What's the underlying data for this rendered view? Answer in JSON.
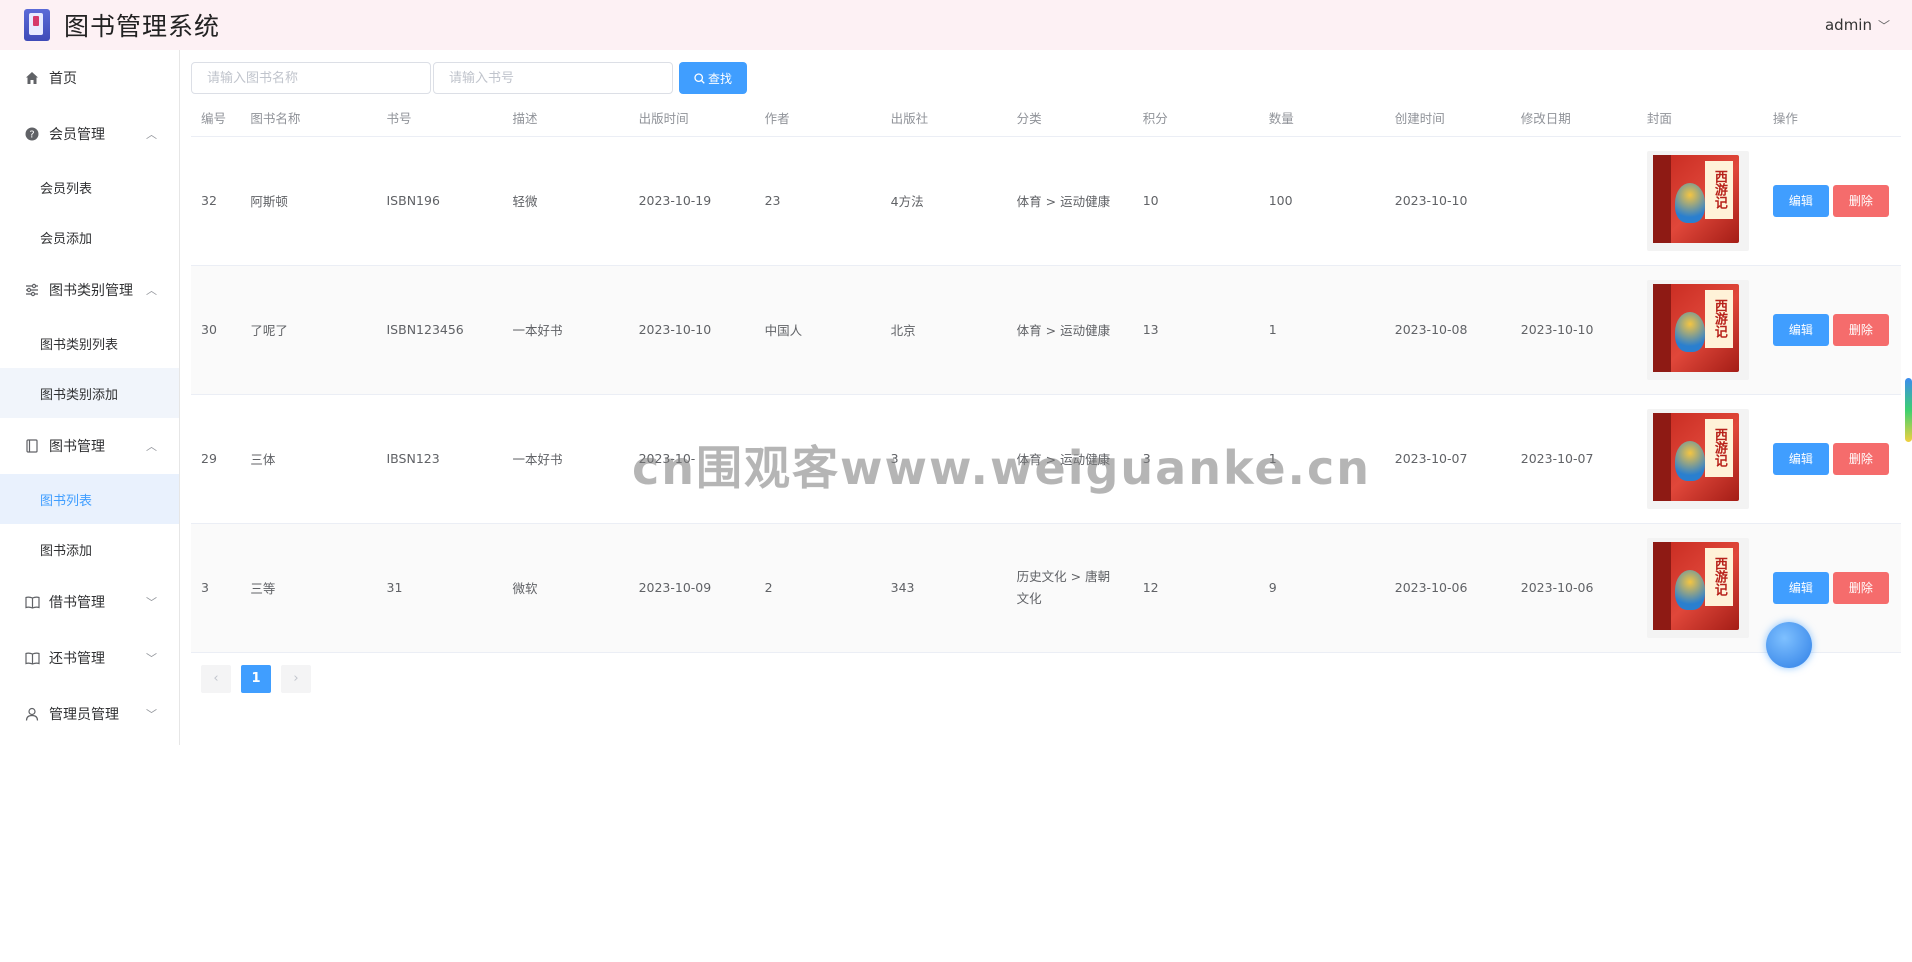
{
  "header": {
    "title": "图书管理系统",
    "user": "admin"
  },
  "sidebar": {
    "items": [
      {
        "label": "首页",
        "icon": "home-icon"
      },
      {
        "label": "会员管理",
        "icon": "question-circle-icon",
        "children": [
          "会员列表",
          "会员添加"
        ]
      },
      {
        "label": "图书类别管理",
        "icon": "sliders-icon",
        "children": [
          "图书类别列表",
          "图书类别添加"
        ]
      },
      {
        "label": "图书管理",
        "icon": "notebook-icon",
        "children": [
          "图书列表",
          "图书添加"
        ]
      },
      {
        "label": "借书管理",
        "icon": "open-book-icon"
      },
      {
        "label": "还书管理",
        "icon": "open-book-icon"
      },
      {
        "label": "管理员管理",
        "icon": "user-icon"
      }
    ]
  },
  "search": {
    "name_placeholder": "请输入图书名称",
    "isbn_placeholder": "请输入书号",
    "button": "查找"
  },
  "table": {
    "columns": [
      "编号",
      "图书名称",
      "书号",
      "描述",
      "出版时间",
      "作者",
      "出版社",
      "分类",
      "积分",
      "数量",
      "创建时间",
      "修改日期",
      "封面",
      "操作"
    ],
    "rows": [
      {
        "id": "32",
        "name": "阿斯顿",
        "isbn": "ISBN196",
        "desc": "轻微",
        "pub_date": "2023-10-19",
        "author": "23",
        "publisher": "4方法",
        "category": "体育 > 运动健康",
        "points": "10",
        "qty": "100",
        "created": "2023-10-10",
        "modified": ""
      },
      {
        "id": "30",
        "name": "了呢了",
        "isbn": "ISBN123456",
        "desc": "一本好书",
        "pub_date": "2023-10-10",
        "author": "中国人",
        "publisher": "北京",
        "category": "体育 > 运动健康",
        "points": "13",
        "qty": "1",
        "created": "2023-10-08",
        "modified": "2023-10-10"
      },
      {
        "id": "29",
        "name": "三体",
        "isbn": "IBSN123",
        "desc": "一本好书",
        "pub_date": "2023-10-",
        "author": "",
        "publisher": "3",
        "category": "体育 > 运动健康",
        "points": "3",
        "qty": "1",
        "created": "2023-10-07",
        "modified": "2023-10-07"
      },
      {
        "id": "3",
        "name": "三等",
        "isbn": "31",
        "desc": "微软",
        "pub_date": "2023-10-09",
        "author": "2",
        "publisher": "343",
        "category": "历史文化 > 唐朝文化",
        "points": "12",
        "qty": "9",
        "created": "2023-10-06",
        "modified": "2023-10-06"
      }
    ],
    "edit_label": "编辑",
    "delete_label": "删除",
    "cover_text": "西游记"
  },
  "pagination": {
    "current": "1",
    "prev": "‹",
    "next": "›"
  },
  "watermark": "cn围观客www.weiguanke.cn",
  "colors": {
    "primary": "#409eff",
    "danger": "#f56c6c",
    "header_bg": "#fdf1f4"
  }
}
